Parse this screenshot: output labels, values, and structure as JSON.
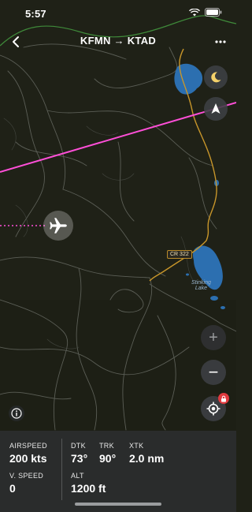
{
  "status": {
    "time": "5:57"
  },
  "header": {
    "route": "KFMN → KTAD"
  },
  "map": {
    "road_label": "CR 322",
    "lake_label_line1": "Stinking",
    "lake_label_line2": "Lake",
    "route_color": "#ff4fd8",
    "road_color": "#c8962a",
    "water_color": "#2c6fb0"
  },
  "controls": {
    "night_icon": "moon-icon",
    "north_icon": "north-arrow-icon",
    "zoom_in": "+",
    "zoom_out": "−",
    "locate_icon": "crosshair-icon",
    "info_icon": "info-icon"
  },
  "panel": {
    "airspeed": {
      "label": "AIRSPEED",
      "value": "200 kts"
    },
    "vspeed": {
      "label": "V. SPEED",
      "value": "0"
    },
    "dtk": {
      "label": "DTK",
      "value": "73°"
    },
    "trk": {
      "label": "TRK",
      "value": "90°"
    },
    "xtk": {
      "label": "XTK",
      "value": "2.0 nm"
    },
    "alt": {
      "label": "ALT",
      "value": "1200 ft"
    }
  }
}
